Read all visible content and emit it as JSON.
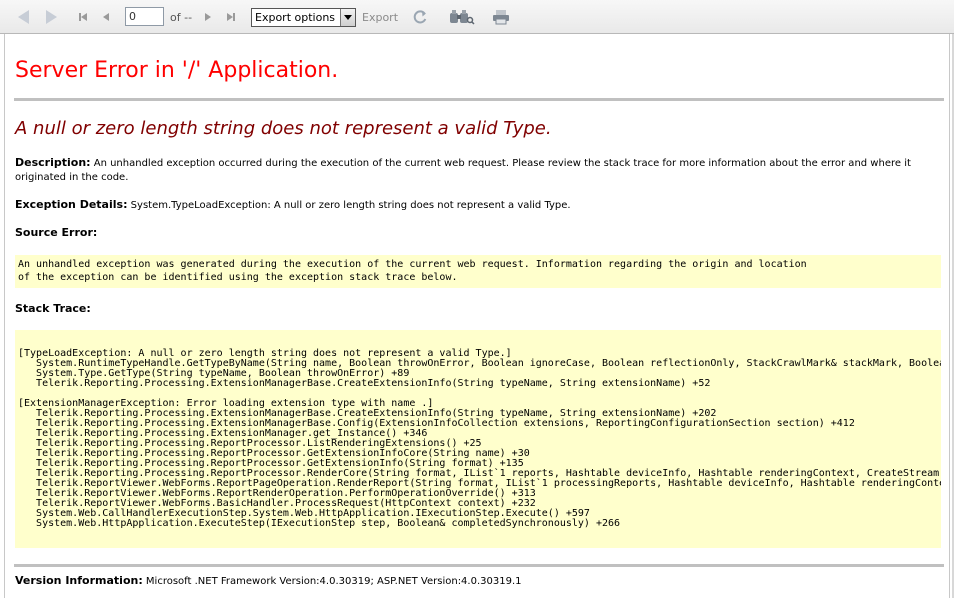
{
  "toolbar": {
    "page_value": "0",
    "of_label": "of --",
    "export_select_value": "Export options",
    "export_label": "Export",
    "icons": [
      "back-icon",
      "forward-icon",
      "first-page-icon",
      "previous-page-icon",
      "next-page-icon",
      "last-page-icon",
      "refresh-icon",
      "search-binoculars-icon",
      "print-icon"
    ]
  },
  "page": {
    "title": "Server Error in '/' Application.",
    "error_title": "A null or zero length string does not represent a valid Type.",
    "description_label": "Description:",
    "description_text": "An unhandled exception occurred during the execution of the current web request. Please review the stack trace for more information about the error and where it originated in the code.",
    "exception_label": "Exception Details:",
    "exception_text": "System.TypeLoadException: A null or zero length string does not represent a valid Type.",
    "source_error_label": "Source Error:",
    "source_error_lines": [
      "An unhandled exception was generated during the execution of the current web request. Information regarding the origin and location",
      "of the exception can be identified using the exception stack trace below."
    ],
    "stack_trace_label": "Stack Trace:",
    "stack_trace_lines": [
      "[TypeLoadException: A null or zero length string does not represent a valid Type.]",
      "   System.RuntimeTypeHandle.GetTypeByName(String name, Boolean throwOnError, Boolean ignoreCase, Boolean reflectionOnly, StackCrawlMark& stackMark, Boolean",
      "   System.Type.GetType(String typeName, Boolean throwOnError) +89",
      "   Telerik.Reporting.Processing.ExtensionManagerBase.CreateExtensionInfo(String typeName, String extensionName) +52",
      "",
      "[ExtensionManagerException: Error loading extension type with name .]",
      "   Telerik.Reporting.Processing.ExtensionManagerBase.CreateExtensionInfo(String typeName, String extensionName) +202",
      "   Telerik.Reporting.Processing.ExtensionManagerBase.Config(ExtensionInfoCollection extensions, ReportingConfigurationSection section) +412",
      "   Telerik.Reporting.Processing.ExtensionManager.get_Instance() +346",
      "   Telerik.Reporting.Processing.ReportProcessor.ListRenderingExtensions() +25",
      "   Telerik.Reporting.Processing.ReportProcessor.GetExtensionInfoCore(String name) +30",
      "   Telerik.Reporting.Processing.ReportProcessor.GetExtensionInfo(String format) +135",
      "   Telerik.Reporting.Processing.ReportProcessor.RenderCore(String format, IList`1 reports, Hashtable deviceInfo, Hashtable renderingContext, CreateStream cr",
      "   Telerik.ReportViewer.WebForms.ReportPageOperation.RenderReport(String format, IList`1 processingReports, Hashtable deviceInfo, Hashtable renderingContext",
      "   Telerik.ReportViewer.WebForms.ReportRenderOperation.PerformOperationOverride() +313",
      "   Telerik.ReportViewer.WebForms.BasicHandler.ProcessRequest(HttpContext context) +232",
      "   System.Web.CallHandlerExecutionStep.System.Web.HttpApplication.IExecutionStep.Execute() +597",
      "   System.Web.HttpApplication.ExecuteStep(IExecutionStep step, Boolean& completedSynchronously) +266"
    ],
    "version_label": "Version Information:",
    "version_text": "Microsoft .NET Framework Version:4.0.30319; ASP.NET Version:4.0.30319.1"
  },
  "colors": {
    "title_red": "#ff0000",
    "error_maroon": "#800000",
    "code_background": "#ffffcc"
  }
}
